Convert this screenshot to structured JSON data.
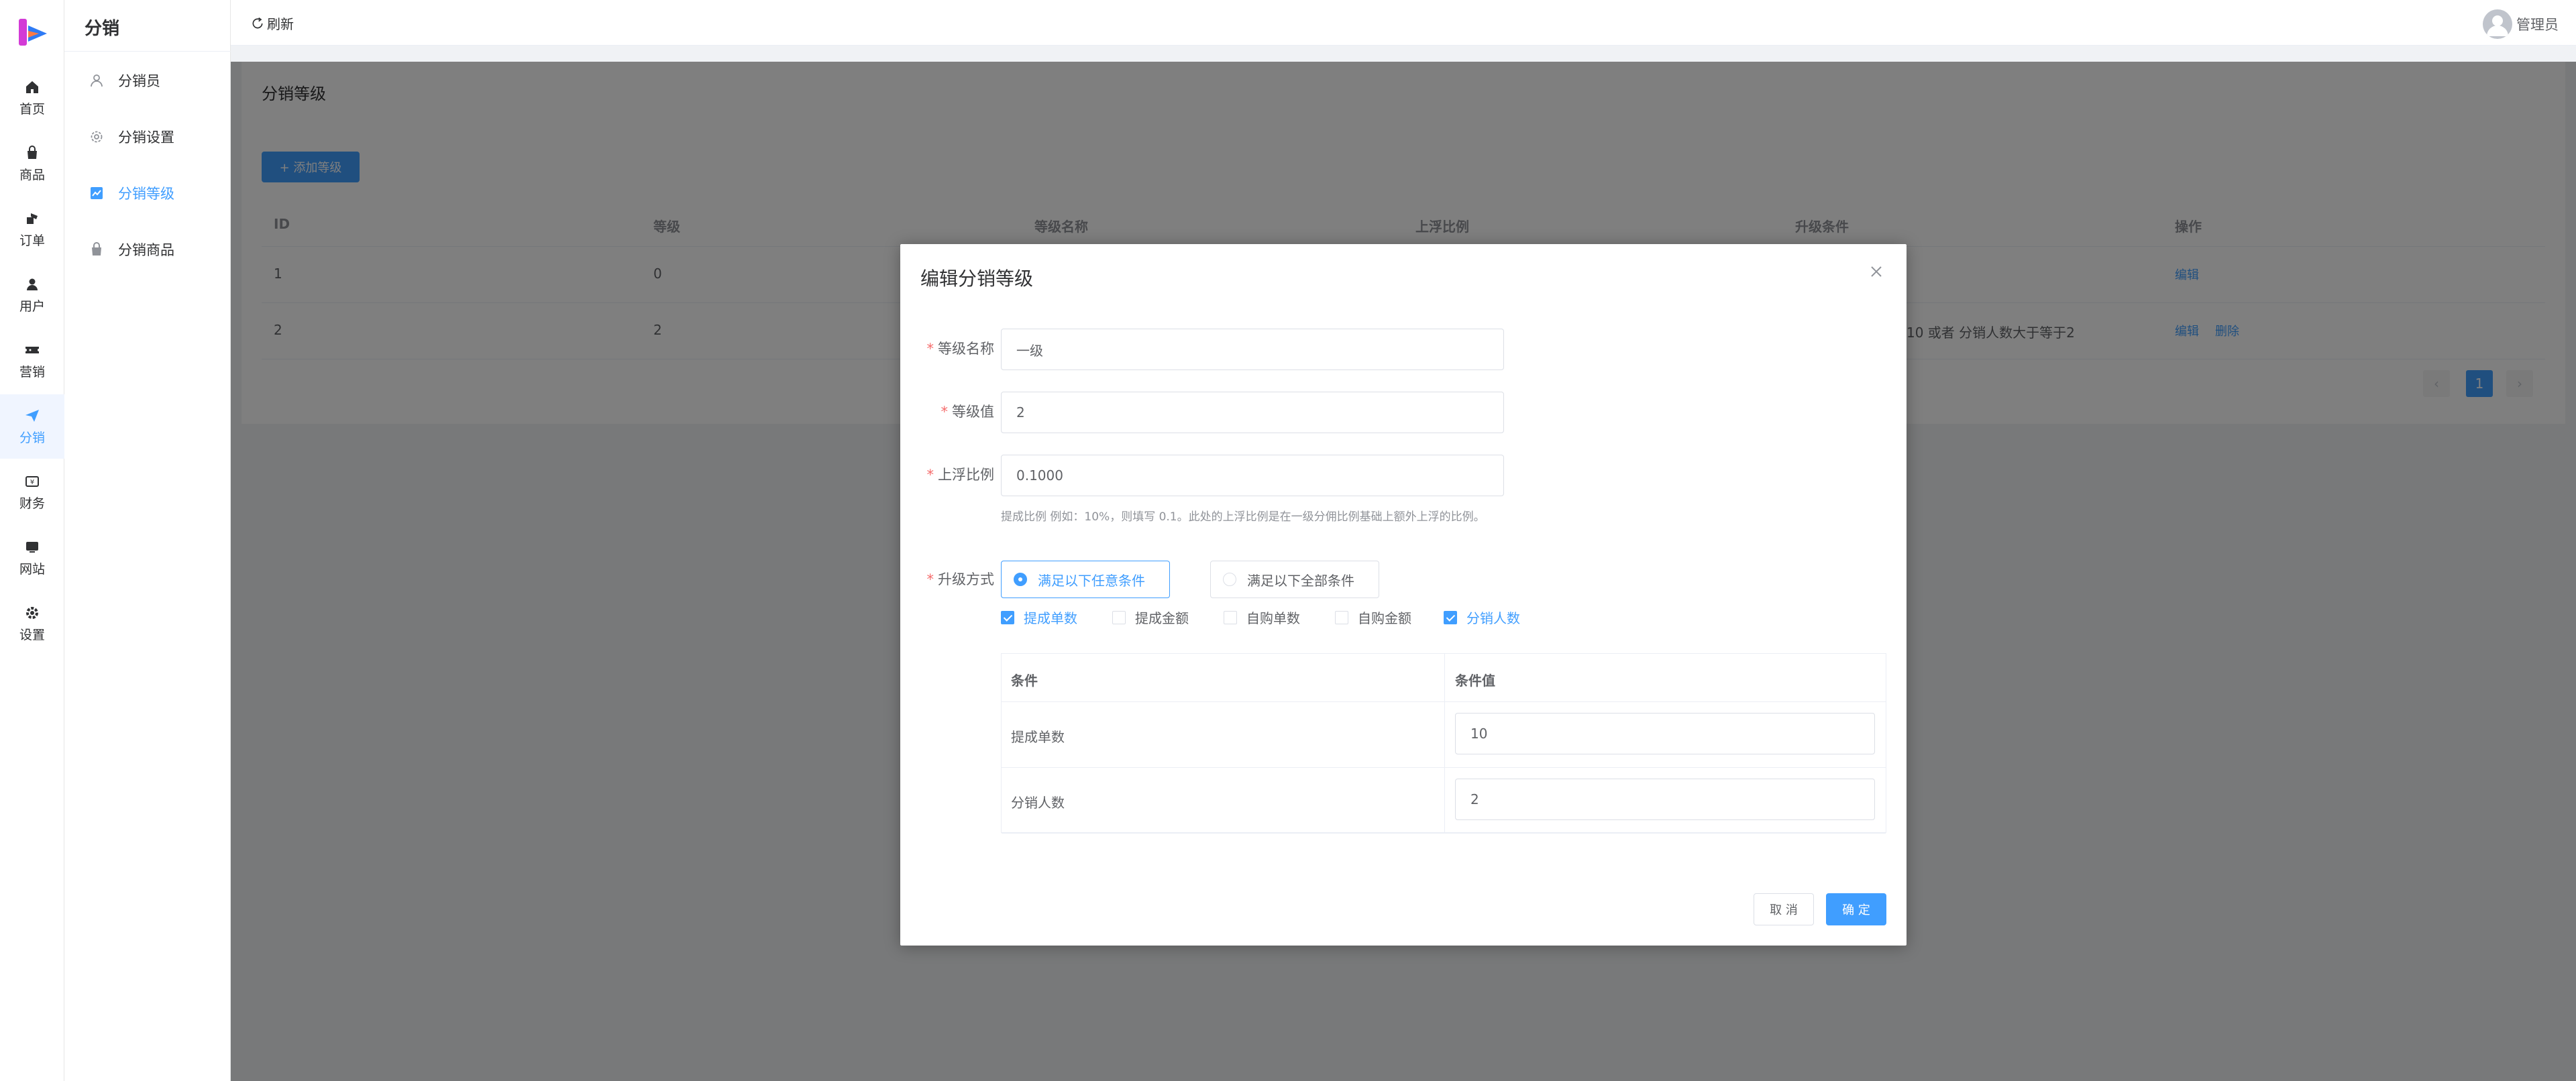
{
  "rail": {
    "items": [
      {
        "label": "首页",
        "icon": "home-icon"
      },
      {
        "label": "商品",
        "icon": "shopping-bag-icon"
      },
      {
        "label": "订单",
        "icon": "order-icon"
      },
      {
        "label": "用户",
        "icon": "user-icon"
      },
      {
        "label": "营销",
        "icon": "ticket-icon"
      },
      {
        "label": "分销",
        "icon": "send-icon",
        "active": true
      },
      {
        "label": "财务",
        "icon": "finance-icon"
      },
      {
        "label": "网站",
        "icon": "website-icon"
      },
      {
        "label": "设置",
        "icon": "gear-icon"
      }
    ]
  },
  "submenu": {
    "title": "分销",
    "items": [
      {
        "label": "分销员",
        "icon": "user-outline-icon"
      },
      {
        "label": "分销设置",
        "icon": "gear-outline-icon"
      },
      {
        "label": "分销等级",
        "icon": "chart-icon",
        "active": true
      },
      {
        "label": "分销商品",
        "icon": "goods-icon"
      }
    ]
  },
  "topbar": {
    "refresh_label": "刷新",
    "user_name": "管理员"
  },
  "page": {
    "title": "分销等级",
    "add_button": "+ 添加等级",
    "table": {
      "headers": [
        "ID",
        "等级",
        "等级名称",
        "上浮比例",
        "升级条件",
        "操作"
      ],
      "rows": [
        {
          "id": "1",
          "level": "0",
          "conditions": "",
          "actions": [
            "编辑"
          ]
        },
        {
          "id": "2",
          "level": "2",
          "conditions": "10 或者 分销人数大于等于2",
          "actions": [
            "编辑",
            "删除"
          ]
        }
      ]
    },
    "pagination": {
      "prev": "‹",
      "current": "1",
      "next": "›"
    }
  },
  "dialog": {
    "title": "编辑分销等级",
    "fields": {
      "name": {
        "label": "等级名称",
        "value": "一级"
      },
      "level": {
        "label": "等级值",
        "value": "2"
      },
      "ratio": {
        "label": "上浮比例",
        "value": "0.1000",
        "hint": "提成比例 例如：10%，则填写 0.1。此处的上浮比例是在一级分佣比例基础上额外上浮的比例。"
      }
    },
    "upgrade": {
      "label": "升级方式",
      "options": [
        {
          "label": "满足以下任意条件",
          "checked": true
        },
        {
          "label": "满足以下全部条件",
          "checked": false
        }
      ],
      "conditions": [
        {
          "label": "提成单数",
          "checked": true
        },
        {
          "label": "提成金额",
          "checked": false
        },
        {
          "label": "自购单数",
          "checked": false
        },
        {
          "label": "自购金额",
          "checked": false
        },
        {
          "label": "分销人数",
          "checked": true
        }
      ]
    },
    "condition_table": {
      "headers": [
        "条件",
        "条件值"
      ],
      "rows": [
        {
          "condition": "提成单数",
          "value": "10"
        },
        {
          "condition": "分销人数",
          "value": "2"
        }
      ]
    },
    "cancel_label": "取 消",
    "ok_label": "确 定"
  },
  "colors": {
    "primary": "#409eff",
    "danger": "#f56c6c",
    "mask": "rgba(0,0,0,0.5)"
  }
}
